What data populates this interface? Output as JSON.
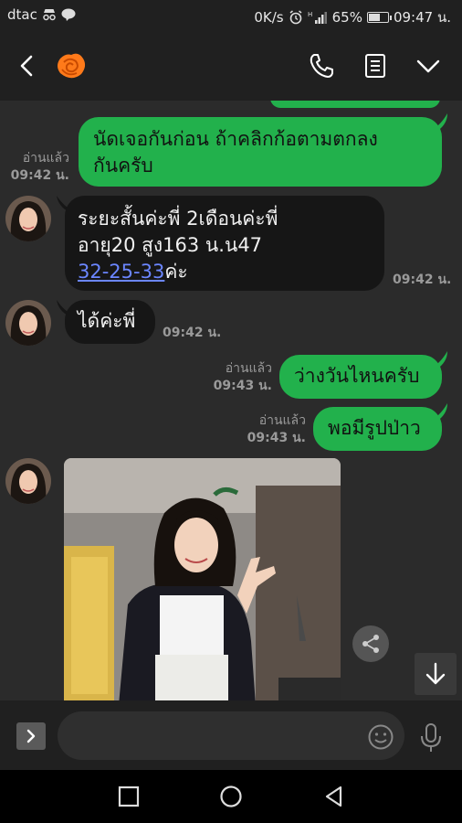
{
  "status_bar": {
    "carrier": "dtac",
    "network_speed": "0K/s",
    "signal_label": "H",
    "battery": "65%",
    "battery_level": 0.65,
    "time": "09:47 น."
  },
  "header": {
    "contact_avatar_icon": "rose-icon",
    "actions": [
      "phone-icon",
      "notes-icon",
      "chevron-down-icon"
    ]
  },
  "messages": [
    {
      "id": "m0",
      "direction": "out",
      "text": "",
      "partial": true
    },
    {
      "id": "m1",
      "direction": "out",
      "lines": [
        "นัดเจอกันก่อน ถ้าคลิกก้อตามตกลง",
        "กันครับ"
      ],
      "read": "อ่านแล้ว",
      "time": "09:42 น."
    },
    {
      "id": "m2",
      "direction": "in",
      "lines": [
        "ระยะสั้นค่ะพี่ 2เดือนค่ะพี่",
        "อายุ20 สูง163 น.น47"
      ],
      "link": "32-25-33",
      "link_suffix": "ค่ะ",
      "time": "09:42 น."
    },
    {
      "id": "m3",
      "direction": "in",
      "text": "ได้ค่ะพี่",
      "time": "09:42 น."
    },
    {
      "id": "m4",
      "direction": "out",
      "text": "ว่างวันไหนครับ",
      "read": "อ่านแล้ว",
      "time": "09:43 น."
    },
    {
      "id": "m5",
      "direction": "out",
      "text": "พอมีรูปป่าว",
      "read": "อ่านแล้ว",
      "time": "09:43 น."
    },
    {
      "id": "m6",
      "direction": "in",
      "type": "photo"
    }
  ],
  "input": {
    "placeholder": "",
    "icons": [
      "expand-icon",
      "emoji-icon",
      "microphone-icon"
    ]
  },
  "nav": [
    "recent-apps-icon",
    "home-icon",
    "back-icon"
  ],
  "colors": {
    "out_bubble": "#22b14c",
    "in_bubble": "#161616",
    "chat_bg": "#2b2b2b",
    "bar_bg": "#202020",
    "link": "#6b86ff"
  }
}
